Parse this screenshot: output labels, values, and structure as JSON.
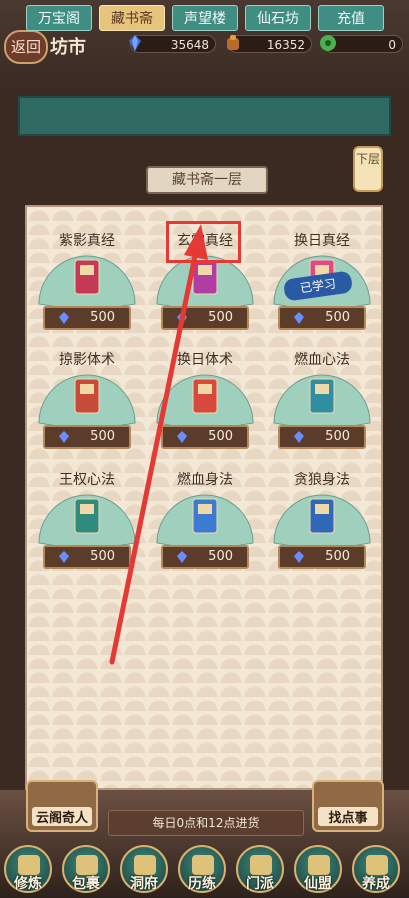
{
  "header": {
    "back_label": "返回",
    "title": "坊市",
    "resources": [
      {
        "icon": "crystal-icon",
        "value": "35648"
      },
      {
        "icon": "treasure-bag-icon",
        "value": "16352"
      },
      {
        "icon": "jade-coin-icon",
        "value": "0"
      }
    ]
  },
  "tabs": [
    {
      "label": "万宝阁",
      "active": false
    },
    {
      "label": "藏书斋",
      "active": true
    },
    {
      "label": "声望楼",
      "active": false
    },
    {
      "label": "仙石坊",
      "active": false
    },
    {
      "label": "充值",
      "active": false
    }
  ],
  "floor": {
    "title": "藏书斋一层",
    "next_floor_label": "下层"
  },
  "books": [
    {
      "name": "紫影真经",
      "price": "500"
    },
    {
      "name": "玄霜真经",
      "price": "500"
    },
    {
      "name": "换日真经",
      "price": "500",
      "stamp": "已学习"
    },
    {
      "name": "掠影体术",
      "price": "500"
    },
    {
      "name": "换日体术",
      "price": "500"
    },
    {
      "name": "燃血心法",
      "price": "500"
    },
    {
      "name": "王权心法",
      "price": "500"
    },
    {
      "name": "燃血身法",
      "price": "500"
    },
    {
      "name": "贪狼身法",
      "price": "500"
    }
  ],
  "shop": {
    "restock_note": "每日0点和12点进货",
    "npc_left": "云阁奇人",
    "npc_right": "找点事"
  },
  "bottom_nav": [
    {
      "label": "修炼",
      "icon": "cultivate-icon"
    },
    {
      "label": "包裹",
      "icon": "bag-icon"
    },
    {
      "label": "洞府",
      "icon": "cave-icon"
    },
    {
      "label": "历练",
      "icon": "scroll-icon"
    },
    {
      "label": "门派",
      "icon": "sect-icon"
    },
    {
      "label": "仙盟",
      "icon": "alliance-icon"
    },
    {
      "label": "养成",
      "icon": "growth-icon"
    }
  ],
  "colors": {
    "accent_red": "#e53935",
    "tab_active": "#e6c47c",
    "tab_inactive": "#3f8d83"
  }
}
